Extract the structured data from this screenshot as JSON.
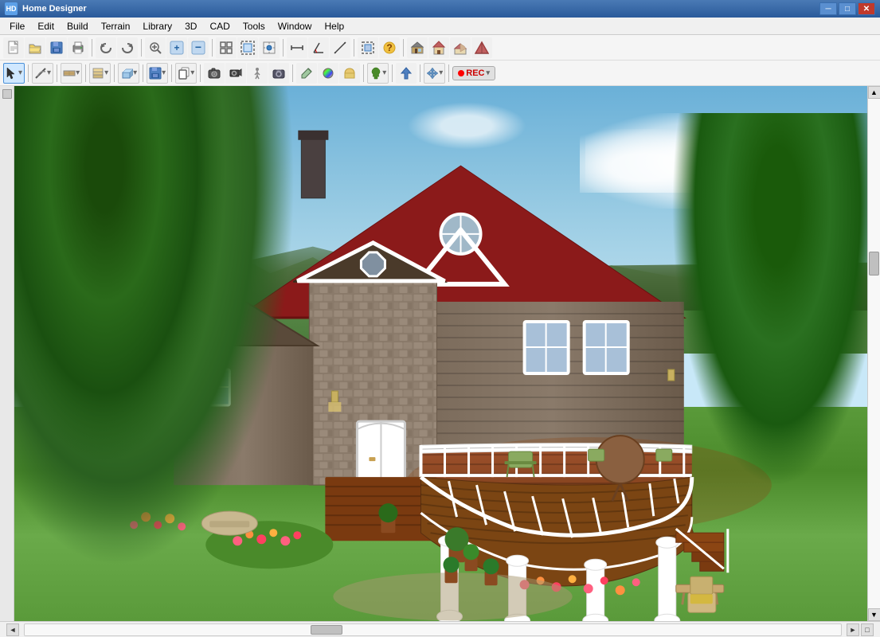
{
  "app": {
    "title": "Home Designer",
    "title_icon": "HD"
  },
  "titlebar": {
    "minimize_label": "─",
    "restore_label": "□",
    "close_label": "✕"
  },
  "menubar": {
    "items": [
      {
        "id": "file",
        "label": "File"
      },
      {
        "id": "edit",
        "label": "Edit"
      },
      {
        "id": "build",
        "label": "Build"
      },
      {
        "id": "terrain",
        "label": "Terrain"
      },
      {
        "id": "library",
        "label": "Library"
      },
      {
        "id": "3d",
        "label": "3D"
      },
      {
        "id": "cad",
        "label": "CAD"
      },
      {
        "id": "tools",
        "label": "Tools"
      },
      {
        "id": "window",
        "label": "Window"
      },
      {
        "id": "help",
        "label": "Help"
      }
    ]
  },
  "toolbar1": {
    "buttons": [
      {
        "id": "new",
        "icon": "new-file-icon",
        "title": "New"
      },
      {
        "id": "open",
        "icon": "open-file-icon",
        "title": "Open"
      },
      {
        "id": "save",
        "icon": "save-icon",
        "title": "Save"
      },
      {
        "id": "print",
        "icon": "print-icon",
        "title": "Print"
      },
      {
        "id": "sep1"
      },
      {
        "id": "undo",
        "icon": "undo-icon",
        "title": "Undo"
      },
      {
        "id": "redo",
        "icon": "redo-icon",
        "title": "Redo"
      },
      {
        "id": "sep2"
      },
      {
        "id": "zoom-in",
        "icon": "zoom-in-icon",
        "title": "Zoom In"
      },
      {
        "id": "zoom-in2",
        "icon": "zoom-in2-icon",
        "title": "Zoom In"
      },
      {
        "id": "zoom-out",
        "icon": "zoom-out-icon",
        "title": "Zoom Out"
      },
      {
        "id": "sep3"
      },
      {
        "id": "fit",
        "icon": "fit-icon",
        "title": "Fit to View"
      },
      {
        "id": "fit2",
        "icon": "fit2-icon",
        "title": "Fit All"
      },
      {
        "id": "snap",
        "icon": "snap-icon",
        "title": "Toggle Snap"
      },
      {
        "id": "sep4"
      },
      {
        "id": "dims",
        "icon": "dims-icon",
        "title": "Dimensions"
      },
      {
        "id": "angle",
        "icon": "angle-icon",
        "title": "Angle"
      },
      {
        "id": "elev",
        "icon": "elev-icon",
        "title": "Elevation"
      },
      {
        "id": "sep5"
      },
      {
        "id": "select-all",
        "icon": "select-all-icon",
        "title": "Select All"
      },
      {
        "id": "question",
        "icon": "question-icon",
        "title": "Help"
      },
      {
        "id": "sep6"
      },
      {
        "id": "interior",
        "icon": "interior-icon",
        "title": "Interior"
      },
      {
        "id": "house",
        "icon": "house-icon",
        "title": "House View"
      },
      {
        "id": "house2",
        "icon": "house2-icon",
        "title": "House Exterior"
      },
      {
        "id": "exterior",
        "icon": "exterior-icon",
        "title": "Exterior View"
      }
    ]
  },
  "toolbar2": {
    "buttons": [
      {
        "id": "select",
        "icon": "select-icon",
        "title": "Select",
        "active": true
      },
      {
        "id": "sep1"
      },
      {
        "id": "line",
        "icon": "line-icon",
        "title": "Line"
      },
      {
        "id": "sep2"
      },
      {
        "id": "wall-dd",
        "icon": "wall-icon",
        "title": "Wall",
        "dropdown": true
      },
      {
        "id": "sep3"
      },
      {
        "id": "layer",
        "icon": "layer-icon",
        "title": "Layer",
        "dropdown": true
      },
      {
        "id": "sep4"
      },
      {
        "id": "box",
        "icon": "box-icon",
        "title": "Box"
      },
      {
        "id": "sep5"
      },
      {
        "id": "save2",
        "icon": "save2-icon",
        "title": "Save View",
        "dropdown": true
      },
      {
        "id": "sep6"
      },
      {
        "id": "copy",
        "icon": "copy-icon",
        "title": "Copy"
      },
      {
        "id": "sep7"
      },
      {
        "id": "camera",
        "icon": "camera-icon",
        "title": "Camera"
      },
      {
        "id": "camera2",
        "icon": "camera2-icon",
        "title": "Camera 2"
      },
      {
        "id": "camera3",
        "icon": "camera3-icon",
        "title": "Camera 3"
      },
      {
        "id": "camera4",
        "icon": "camera4-icon",
        "title": "Camera 4"
      },
      {
        "id": "sep8"
      },
      {
        "id": "paint",
        "icon": "paint-icon",
        "title": "Paint"
      },
      {
        "id": "colorpick",
        "icon": "colorpick-icon",
        "title": "Color Picker"
      },
      {
        "id": "texture",
        "icon": "texture-icon",
        "title": "Texture"
      },
      {
        "id": "sep9"
      },
      {
        "id": "tree",
        "icon": "tree-icon",
        "title": "Place Tree",
        "dropdown": true
      },
      {
        "id": "sep10"
      },
      {
        "id": "arrow-up",
        "icon": "arrow-up-icon",
        "title": "Arrow Up"
      },
      {
        "id": "sep11"
      },
      {
        "id": "move",
        "icon": "move-icon",
        "title": "Move/Rotate",
        "dropdown": true
      },
      {
        "id": "sep12"
      },
      {
        "id": "rec",
        "icon": "rec-icon",
        "title": "Record",
        "dropdown": true
      }
    ]
  },
  "statusbar": {
    "text": ""
  },
  "canvas": {
    "scene_description": "3D house render with garden and deck"
  }
}
